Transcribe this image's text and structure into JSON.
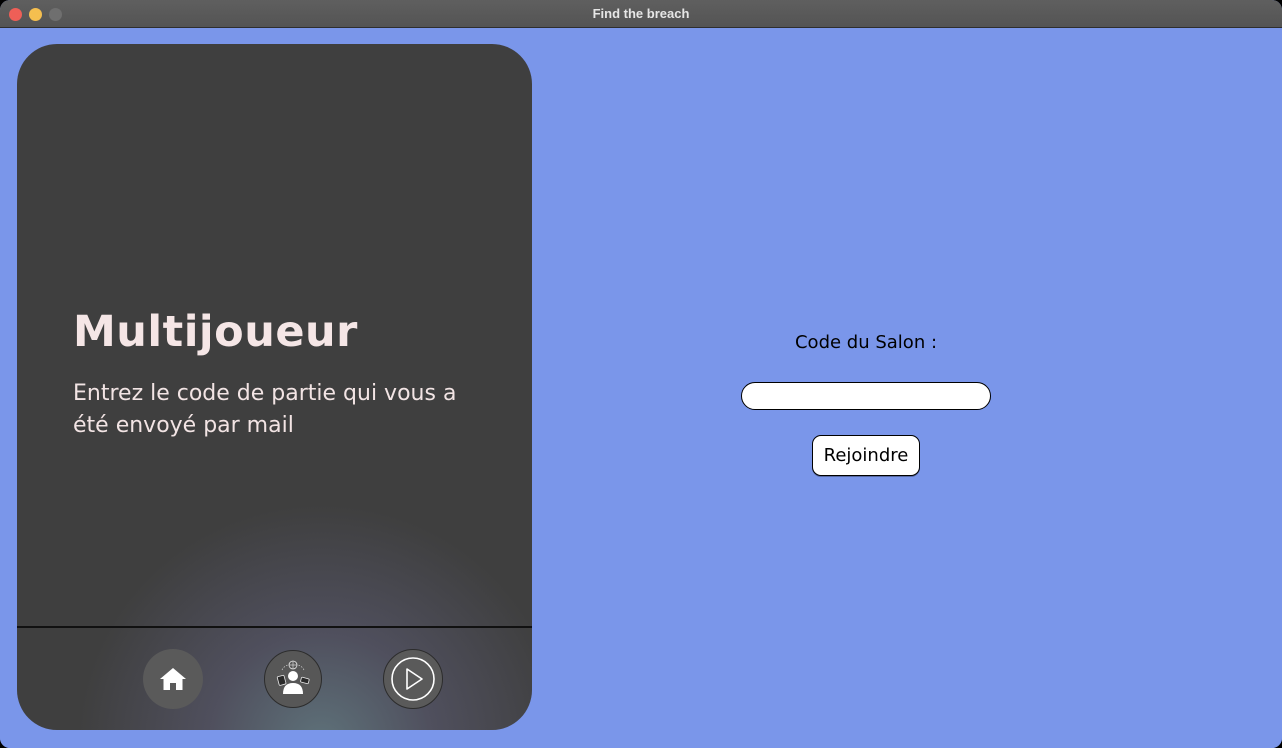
{
  "window": {
    "title": "Find the breach"
  },
  "panel": {
    "title": "Multijoueur",
    "description": "Entrez le code de partie qui vous a été envoyé par mail"
  },
  "nav": {
    "items": [
      {
        "icon": "home-icon"
      },
      {
        "icon": "players-icon"
      },
      {
        "icon": "play-icon"
      }
    ]
  },
  "join_form": {
    "label": "Code du Salon :",
    "input_value": "",
    "input_placeholder": "",
    "button_label": "Rejoindre"
  },
  "colors": {
    "background": "#7a96ea",
    "panel": "#3f3f3f",
    "panel_text": "#f5e6e6"
  }
}
